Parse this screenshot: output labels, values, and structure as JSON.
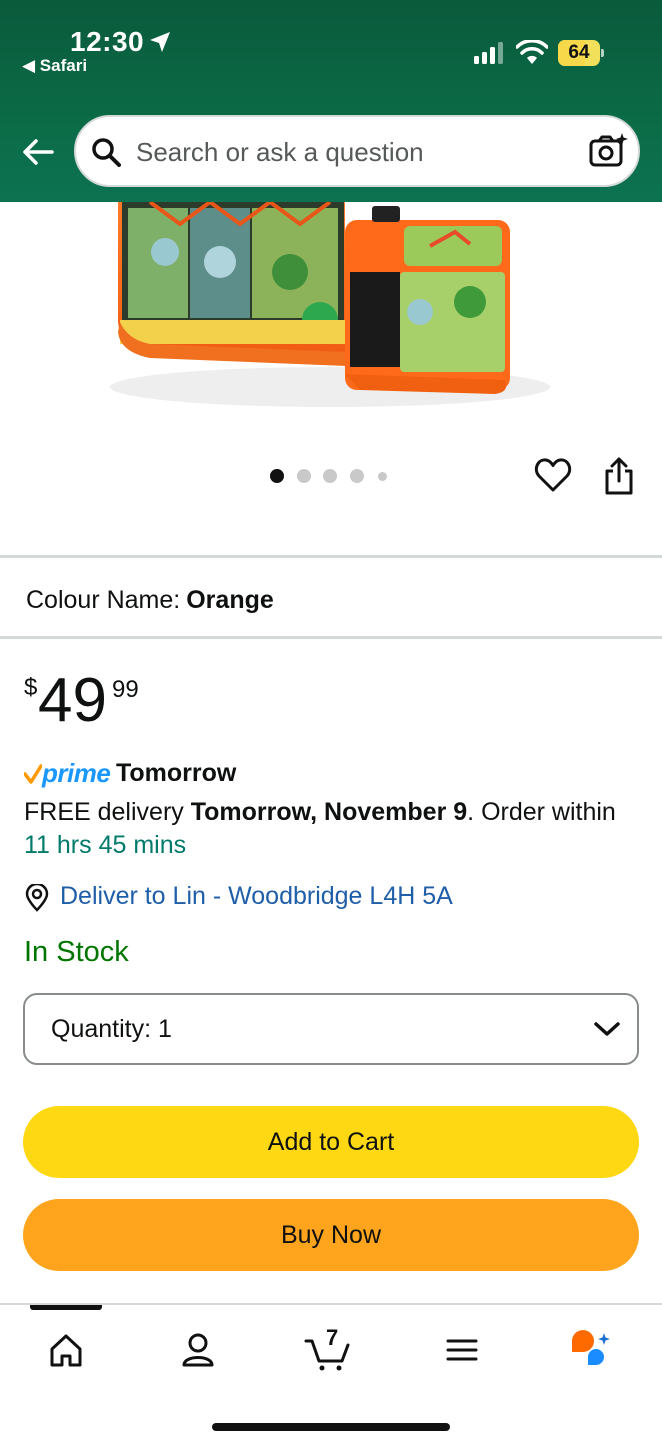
{
  "status_bar": {
    "time": "12:30",
    "back_app": "◀ Safari",
    "battery": "64"
  },
  "header": {
    "search_placeholder": "Search or ask a question",
    "back_icon": "arrow-left-icon",
    "camera_icon": "camera-sparkle-icon"
  },
  "gallery": {
    "image_count": 5,
    "active_index": 0
  },
  "product": {
    "colour_label": "Colour Name:",
    "colour_value": "Orange",
    "price_symbol": "$",
    "price_whole": "49",
    "price_fraction": "99"
  },
  "delivery": {
    "prime_label": "prime",
    "prime_when": "Tomorrow",
    "free_delivery_prefix": "FREE delivery ",
    "delivery_date": "Tomorrow, November 9",
    "order_within_prefix": ". Order within ",
    "countdown": "11 hrs 45 mins",
    "deliver_to": "Deliver to Lin - Woodbridge L4H 5A",
    "stock_status": "In Stock"
  },
  "purchase": {
    "quantity_label": "Quantity:",
    "quantity_value": "1",
    "add_to_cart": "Add to Cart",
    "buy_now": "Buy Now"
  },
  "bottom_nav": {
    "cart_count": "7",
    "items": [
      "home-icon",
      "account-icon",
      "cart-icon",
      "menu-icon",
      "rufus-icon"
    ]
  },
  "colors": {
    "header_green": "#0b6b47",
    "add_to_cart": "#ffd814",
    "buy_now": "#ffa41c",
    "in_stock": "#007600",
    "link_blue": "#1f5ea8",
    "prime_blue": "#1a98ff"
  }
}
